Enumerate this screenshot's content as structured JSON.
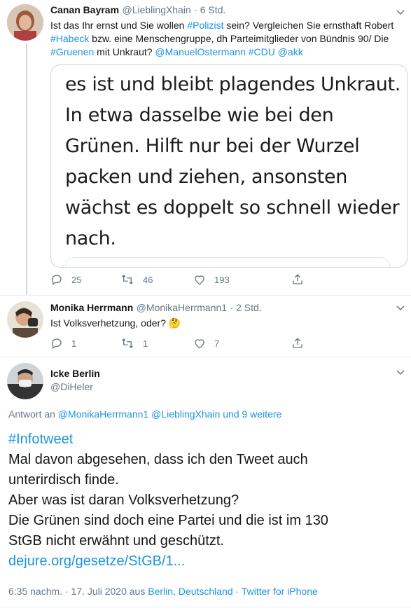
{
  "tweet1": {
    "name": "Canan Bayram",
    "handle": "@LieblingXhain",
    "time": "· 6 Std.",
    "text_parts": [
      "Ist das Ihr ernst und Sie wollen ",
      "#Polizist",
      " sein? Vergleichen Sie ernsthaft Robert ",
      "#Habeck",
      " bzw. eine Menschengruppe, dh Parteimitglieder von Bündnis 90/ Die ",
      "#Gruenen",
      " mit Unkraut? ",
      "@ManuelOstermann",
      " ",
      "#CDU",
      " ",
      "@akk"
    ],
    "quote_lines": [
      "es ist und bleibt plagendes Unkraut.",
      "In etwa dasselbe wie bei den",
      "Grünen. Hilft nur bei der Wurzel",
      "packen und ziehen, ansonsten",
      "wächst es doppelt so schnell wieder",
      "nach."
    ],
    "replies": "25",
    "retweets": "46",
    "likes": "193"
  },
  "tweet2": {
    "name": "Monika Herrmann",
    "handle": "@MonikaHerrmann1",
    "time": "· 2 Std.",
    "text": "Ist Volksverhetzung, oder? 🤔",
    "replies": "1",
    "retweets": "1",
    "likes": "7"
  },
  "tweet3": {
    "name": "Icke Berlin",
    "handle": "@DiHeler",
    "reply_to_prefix": "Antwort an ",
    "reply_to_users": "@MonikaHerrmann1 @LieblingXhain und 9 weitere",
    "hashtag": "#Infotweet",
    "body_lines": [
      "Mal davon abgesehen, dass ich den Tweet auch",
      "unterirdisch finde.",
      "Aber was ist daran Volksverhetzung?",
      "Die Grünen sind doch eine Partei und die ist im 130",
      "StGB nicht erwähnt und geschützt."
    ],
    "link": "dejure.org/gesetze/StGB/1...",
    "footer_time": "6:35 nachm. · 17. Juli 2020 aus ",
    "footer_location": "Berlin, Deutschland",
    "footer_sep": " · ",
    "footer_source": "Twitter for iPhone"
  },
  "colors": {
    "link": "#1b95e0",
    "muted": "#657786"
  }
}
